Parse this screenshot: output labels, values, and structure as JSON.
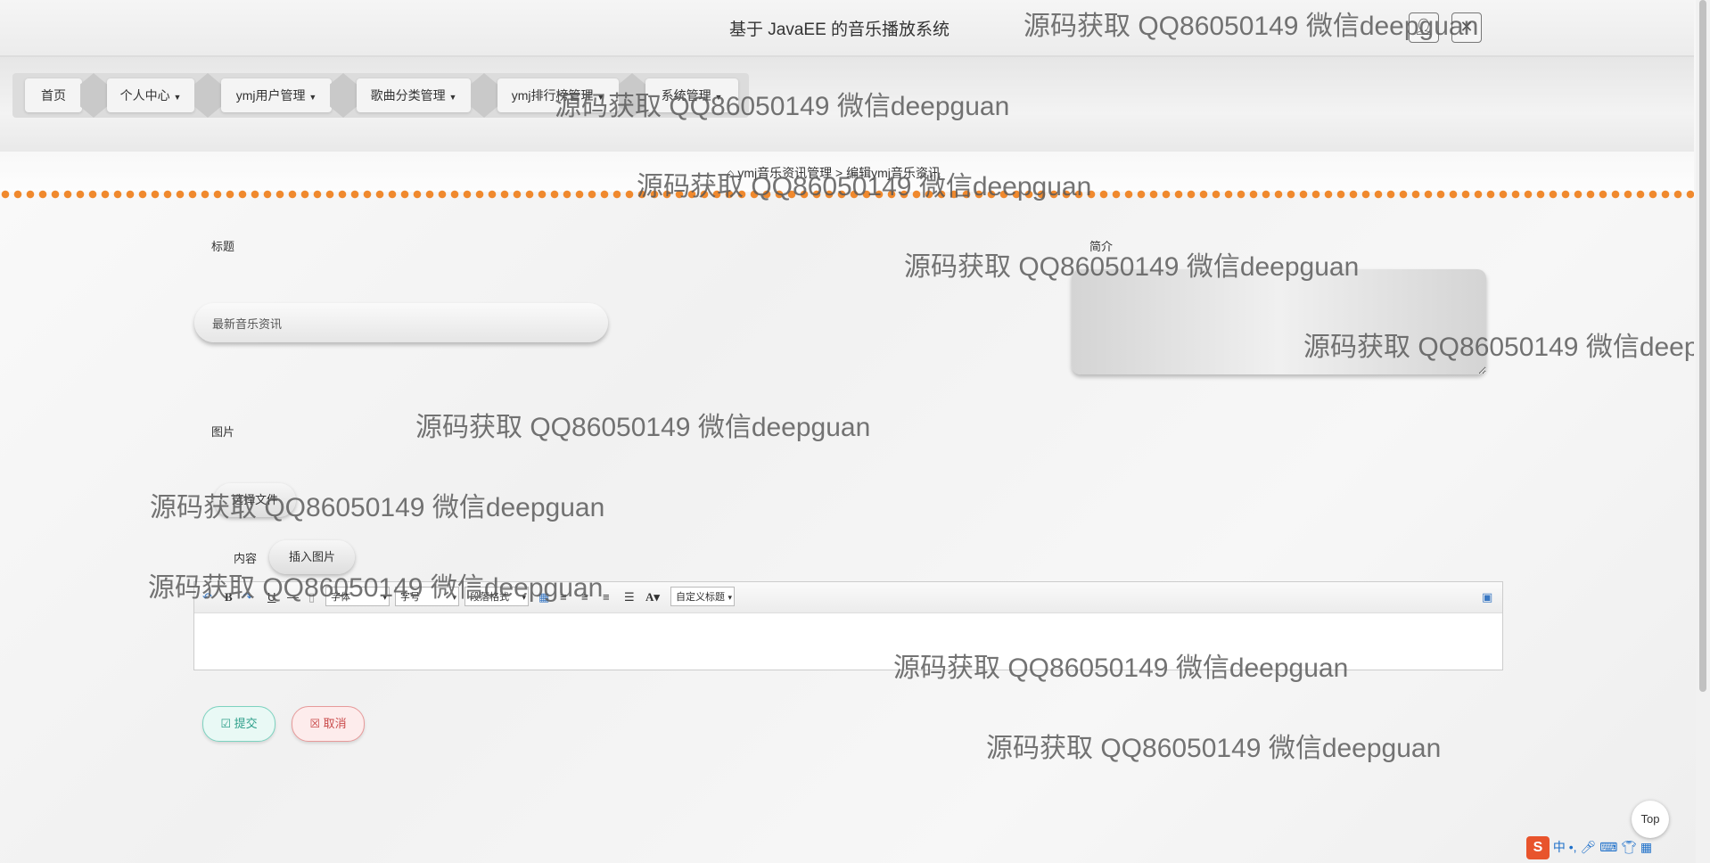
{
  "header": {
    "title": "基于 JavaEE 的音乐播放系统",
    "user_icon": "person-icon",
    "close_icon": "close-icon"
  },
  "nav": {
    "items": [
      {
        "label": "首页"
      },
      {
        "label": "个人中心"
      },
      {
        "label": "ymj用户管理"
      },
      {
        "label": "歌曲分类管理"
      },
      {
        "label": "ymj排行榜管理"
      },
      {
        "label": "系统管理"
      }
    ]
  },
  "breadcrumb": {
    "home_icon": "home-icon",
    "parent": "ymj音乐资讯管理",
    "separator": ">",
    "current": "编辑ymj音乐资讯"
  },
  "form": {
    "title_label": "标题",
    "title_value": "最新音乐资讯",
    "intro_label": "简介",
    "image_label": "图片",
    "file_button": "选择文件",
    "content_label": "内容",
    "insert_image": "插入图片",
    "toolbar": {
      "font": "字体",
      "size": "字号",
      "paragraph": "段落格式",
      "custom_title": "自定义标题"
    },
    "submit": "提交",
    "cancel": "取消"
  },
  "back_to_top": "Top",
  "watermark": "源码获取 QQ86050149 微信deepguan",
  "ime": {
    "lang": "中"
  },
  "colors": {
    "accent_orange": "#f0892d",
    "submit": "#2e9f8a",
    "cancel": "#c94a4a"
  }
}
